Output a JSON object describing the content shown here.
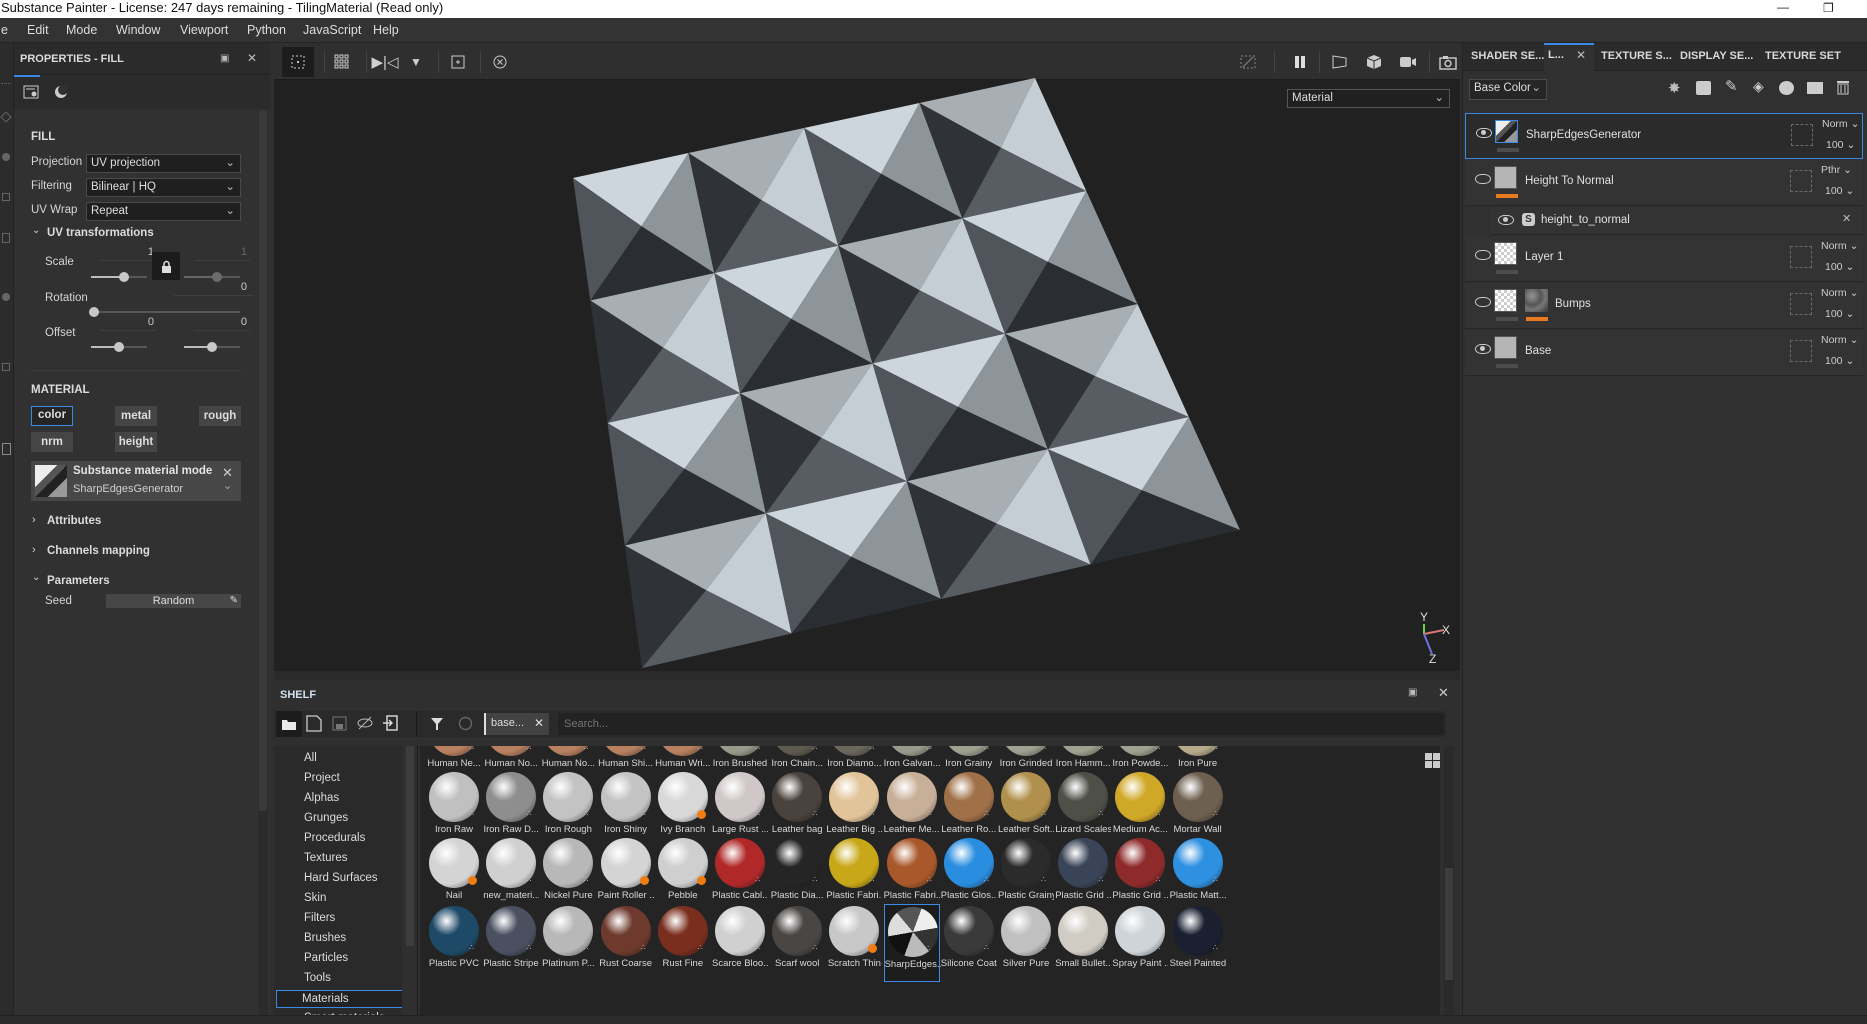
{
  "window": {
    "title": "Substance Painter - License: 247 days remaining - TilingMaterial (Read only)",
    "minimize_icon": "minimize-icon",
    "restore_icon": "restore-icon"
  },
  "menu": [
    "e",
    "Edit",
    "Mode",
    "Window",
    "Viewport",
    "Python",
    "JavaScript",
    "Help"
  ],
  "properties": {
    "title": "PROPERTIES - FILL",
    "tabs": [
      "settings-icon",
      "material-sphere-icon"
    ],
    "fill": {
      "heading": "FILL",
      "projection_label": "Projection",
      "projection_value": "UV projection",
      "filtering_label": "Filtering",
      "filtering_value": "Bilinear | HQ",
      "uvwrap_label": "UV Wrap",
      "uvwrap_value": "Repeat",
      "uv_transform_heading": "UV transformations",
      "scale_label": "Scale",
      "scale_u": "1",
      "scale_v": "1",
      "rotation_label": "Rotation",
      "rotation_value": "0",
      "offset_label": "Offset",
      "offset_u": "0",
      "offset_v": "0"
    },
    "material": {
      "heading": "MATERIAL",
      "channels": [
        {
          "label": "color",
          "active": true
        },
        {
          "label": "metal",
          "active": false
        },
        {
          "label": "rough",
          "active": false
        },
        {
          "label": "nrm",
          "active": false
        },
        {
          "label": "height",
          "active": false
        }
      ],
      "mode_title": "Substance material mode",
      "mode_value": "SharpEdgesGenerator"
    },
    "attributes_heading": "Attributes",
    "channels_mapping_heading": "Channels mapping",
    "parameters_heading": "Parameters",
    "seed_label": "Seed",
    "seed_value": "Random"
  },
  "viewport": {
    "mode_select": "Material",
    "axes": {
      "y": "Y",
      "x": "X",
      "z": "Z"
    }
  },
  "layers": {
    "tabs": [
      {
        "label": "SHADER SE...",
        "active": false
      },
      {
        "label": "L...",
        "active": true
      },
      {
        "label": "TEXTURE S...",
        "active": false
      },
      {
        "label": "DISPLAY SE...",
        "active": false
      },
      {
        "label": "TEXTURE SET SE...",
        "active": false
      }
    ],
    "channel_select": "Base Color",
    "items": [
      {
        "name": "SharpEdgesGenerator",
        "blend": "Norm",
        "opacity": "100",
        "visible": true,
        "selected": true
      },
      {
        "name": "Height To Normal",
        "blend": "Pthr",
        "opacity": "100",
        "visible": false,
        "selected": false
      },
      {
        "name": "height_to_normal",
        "effect": true
      },
      {
        "name": "Layer 1",
        "blend": "Norm",
        "opacity": "100",
        "visible": false,
        "selected": false
      },
      {
        "name": "Bumps",
        "blend": "Norm",
        "opacity": "100",
        "visible": false,
        "selected": false
      },
      {
        "name": "Base",
        "blend": "Norm",
        "opacity": "100",
        "visible": true,
        "selected": false
      }
    ]
  },
  "shelf": {
    "title": "SHELF",
    "filter_tag": "base...",
    "search_placeholder": "Search...",
    "categories": [
      "All",
      "Project",
      "Alphas",
      "Grunges",
      "Procedurals",
      "Textures",
      "Hard Surfaces",
      "Skin",
      "Filters",
      "Brushes",
      "Particles",
      "Tools",
      "Materials",
      "Smart materials"
    ],
    "active_category": "Materials",
    "materials": [
      [
        "Human Ne...",
        "Human No...",
        "Human No...",
        "Human Shi...",
        "Human Wri...",
        "Iron Brushed",
        "Iron Chain...",
        "Iron Diamo...",
        "Iron Galvan...",
        "Iron Grainy",
        "Iron Grinded",
        "Iron Hamm...",
        "Iron Powde...",
        "Iron Pure"
      ],
      [
        "Iron Raw",
        "Iron Raw D...",
        "Iron Rough",
        "Iron Shiny",
        "Ivy Branch",
        "Large Rust ...",
        "Leather bag",
        "Leather Big ...",
        "Leather Me...",
        "Leather Ro...",
        "Leather Soft...",
        "Lizard Scales",
        "Medium Ac...",
        "Mortar Wall"
      ],
      [
        "Nail",
        "new_materi...",
        "Nickel Pure",
        "Paint Roller ...",
        "Pebble",
        "Plastic Cabl...",
        "Plastic Dia...",
        "Plastic Fabri...",
        "Plastic Fabri...",
        "Plastic Glos...",
        "Plastic Grainy",
        "Plastic Grid ...",
        "Plastic Grid ...",
        "Plastic Matt..."
      ],
      [
        "Plastic PVC",
        "Plastic Stripes",
        "Platinum P...",
        "Rust Coarse",
        "Rust Fine",
        "Scarce Bloo...",
        "Scarf wool",
        "Scratch Thin",
        "SharpEdges...",
        "Silicone Coat",
        "Silver Pure",
        "Small Bullet...",
        "Spray Paint ...",
        "Steel Painted"
      ]
    ],
    "selected_material": "SharpEdges..."
  },
  "colors": {
    "accent": "#3a8be8",
    "mask_orange": "#e87a1f",
    "panel_bg": "#313131",
    "viewport_bg": "#212121"
  }
}
